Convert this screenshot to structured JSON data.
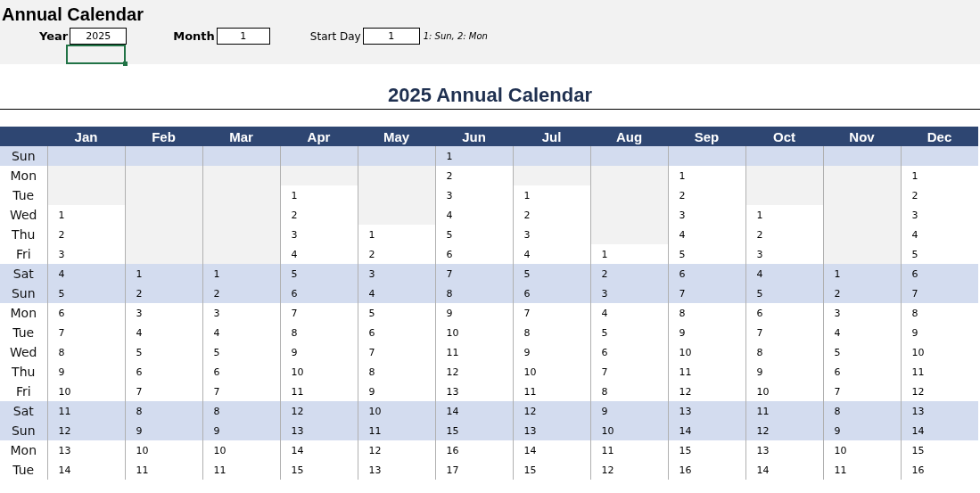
{
  "sheet_title": "Annual Calendar",
  "inputs": [
    {
      "label": "Year",
      "value": "2025",
      "bold": true
    },
    {
      "label": "Month",
      "value": "1",
      "bold": true
    },
    {
      "label": "Start Day",
      "value": "1",
      "bold": false,
      "hint": "1: Sun, 2: Mon"
    }
  ],
  "calendar_title": "2025 Annual Calendar",
  "months": [
    "Jan",
    "Feb",
    "Mar",
    "Apr",
    "May",
    "Jun",
    "Jul",
    "Aug",
    "Sep",
    "Oct",
    "Nov",
    "Dec"
  ],
  "rows": [
    {
      "day": "Sun",
      "weekend": true,
      "cells": [
        null,
        null,
        null,
        null,
        null,
        "1",
        null,
        null,
        null,
        null,
        null,
        null
      ]
    },
    {
      "day": "Mon",
      "weekend": false,
      "cells": [
        null,
        null,
        null,
        null,
        null,
        "2",
        null,
        null,
        "1",
        null,
        null,
        "1"
      ]
    },
    {
      "day": "Tue",
      "weekend": false,
      "cells": [
        null,
        null,
        null,
        "1",
        null,
        "3",
        "1",
        null,
        "2",
        null,
        null,
        "2"
      ]
    },
    {
      "day": "Wed",
      "weekend": false,
      "cells": [
        "1",
        null,
        null,
        "2",
        null,
        "4",
        "2",
        null,
        "3",
        "1",
        null,
        "3"
      ]
    },
    {
      "day": "Thu",
      "weekend": false,
      "cells": [
        "2",
        null,
        null,
        "3",
        "1",
        "5",
        "3",
        null,
        "4",
        "2",
        null,
        "4"
      ]
    },
    {
      "day": "Fri",
      "weekend": false,
      "cells": [
        "3",
        null,
        null,
        "4",
        "2",
        "6",
        "4",
        "1",
        "5",
        "3",
        null,
        "5"
      ]
    },
    {
      "day": "Sat",
      "weekend": true,
      "cells": [
        "4",
        "1",
        "1",
        "5",
        "3",
        "7",
        "5",
        "2",
        "6",
        "4",
        "1",
        "6"
      ]
    },
    {
      "day": "Sun",
      "weekend": true,
      "cells": [
        "5",
        "2",
        "2",
        "6",
        "4",
        "8",
        "6",
        "3",
        "7",
        "5",
        "2",
        "7"
      ]
    },
    {
      "day": "Mon",
      "weekend": false,
      "cells": [
        "6",
        "3",
        "3",
        "7",
        "5",
        "9",
        "7",
        "4",
        "8",
        "6",
        "3",
        "8"
      ]
    },
    {
      "day": "Tue",
      "weekend": false,
      "cells": [
        "7",
        "4",
        "4",
        "8",
        "6",
        "10",
        "8",
        "5",
        "9",
        "7",
        "4",
        "9"
      ]
    },
    {
      "day": "Wed",
      "weekend": false,
      "cells": [
        "8",
        "5",
        "5",
        "9",
        "7",
        "11",
        "9",
        "6",
        "10",
        "8",
        "5",
        "10"
      ]
    },
    {
      "day": "Thu",
      "weekend": false,
      "cells": [
        "9",
        "6",
        "6",
        "10",
        "8",
        "12",
        "10",
        "7",
        "11",
        "9",
        "6",
        "11"
      ]
    },
    {
      "day": "Fri",
      "weekend": false,
      "cells": [
        "10",
        "7",
        "7",
        "11",
        "9",
        "13",
        "11",
        "8",
        "12",
        "10",
        "7",
        "12"
      ]
    },
    {
      "day": "Sat",
      "weekend": true,
      "cells": [
        "11",
        "8",
        "8",
        "12",
        "10",
        "14",
        "12",
        "9",
        "13",
        "11",
        "8",
        "13"
      ]
    },
    {
      "day": "Sun",
      "weekend": true,
      "cells": [
        "12",
        "9",
        "9",
        "13",
        "11",
        "15",
        "13",
        "10",
        "14",
        "12",
        "9",
        "14"
      ]
    },
    {
      "day": "Mon",
      "weekend": false,
      "cells": [
        "13",
        "10",
        "10",
        "14",
        "12",
        "16",
        "14",
        "11",
        "15",
        "13",
        "10",
        "15"
      ]
    },
    {
      "day": "Tue",
      "weekend": false,
      "cells": [
        "14",
        "11",
        "11",
        "15",
        "13",
        "17",
        "15",
        "12",
        "16",
        "14",
        "11",
        "16"
      ]
    }
  ]
}
